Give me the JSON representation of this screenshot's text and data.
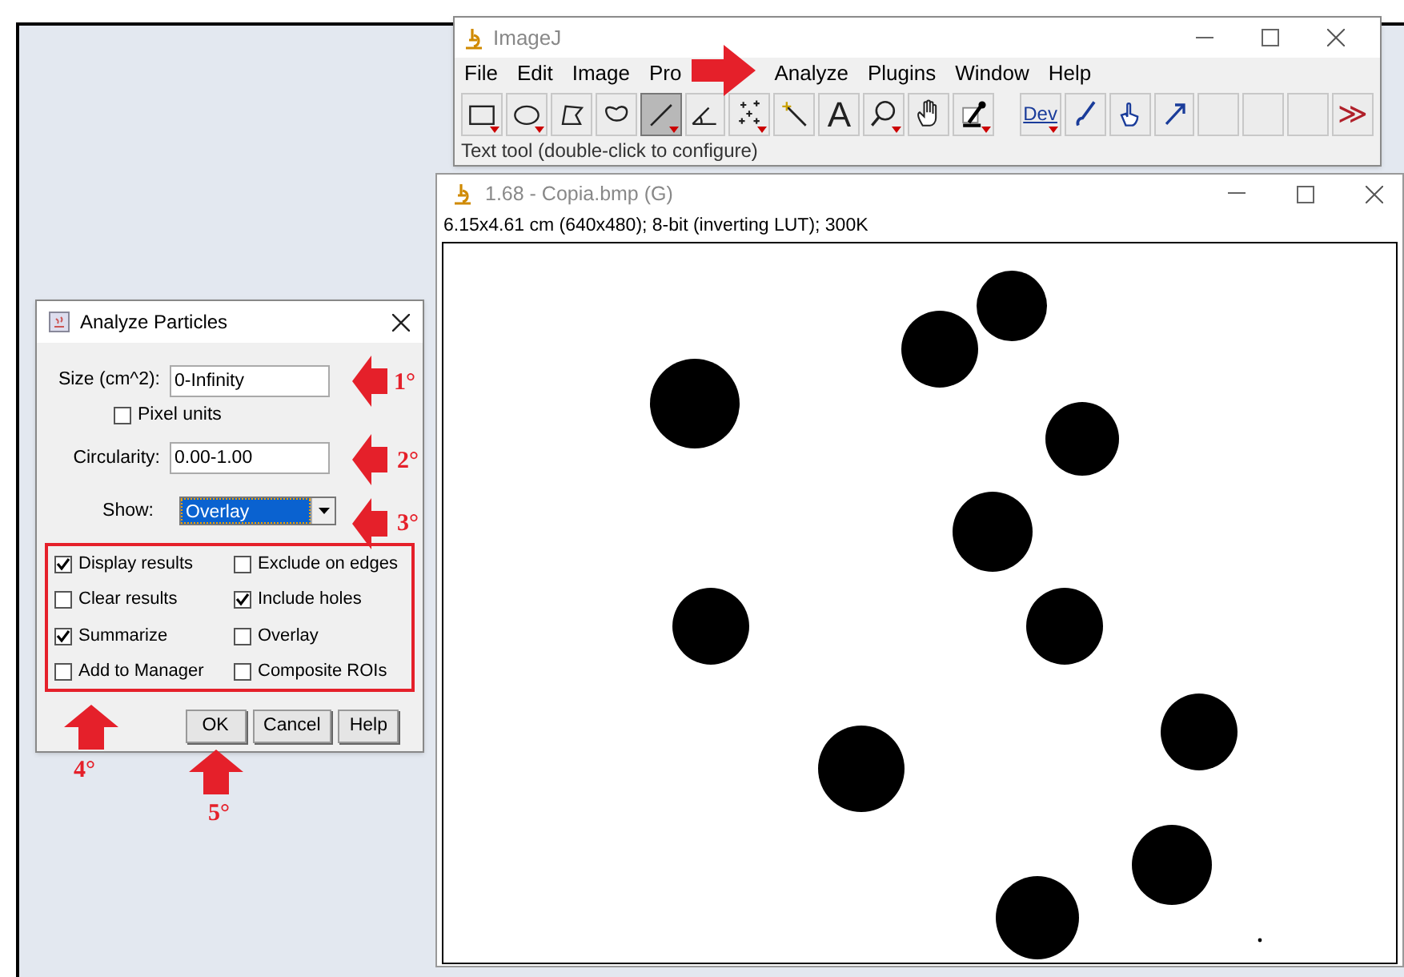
{
  "imagej_window": {
    "title": "ImageJ",
    "menu": [
      "File",
      "Edit",
      "Image",
      "Pro",
      "Analyze",
      "Plugins",
      "Window",
      "Help"
    ],
    "tools": [
      {
        "selected": false
      },
      {
        "selected": false
      },
      {
        "selected": false
      },
      {
        "selected": false
      },
      {
        "selected": true
      },
      {
        "selected": false
      },
      {
        "selected": false
      },
      {
        "selected": false
      },
      {
        "selected": false,
        "label": "A"
      },
      {
        "selected": false
      },
      {
        "selected": false
      },
      {
        "selected": false
      },
      {
        "selected": false,
        "label": "Dev"
      },
      {
        "selected": false
      },
      {
        "selected": false
      },
      {
        "selected": false
      },
      {
        "selected": false
      },
      {
        "selected": false
      },
      {
        "selected": false
      },
      {
        "selected": false,
        "label": "≫"
      }
    ],
    "status": "Text tool (double-click to configure)"
  },
  "image_window": {
    "title": "1.68 - Copia.bmp (G)",
    "info": "6.15x4.61 cm (640x480); 8-bit (inverting LUT); 300K"
  },
  "dialog": {
    "title": "Analyze Particles",
    "fields": [
      {
        "label": "Size (cm^2):",
        "value": "0-Infinity"
      },
      {
        "label": "Circularity:",
        "value": "0.00-1.00"
      }
    ],
    "pixel_units": {
      "label": "Pixel units",
      "checked": false
    },
    "show": {
      "label": "Show:",
      "value": "Overlay"
    },
    "options": [
      {
        "label": "Display results",
        "checked": true
      },
      {
        "label": "Exclude on edges",
        "checked": false
      },
      {
        "label": "Clear results",
        "checked": false
      },
      {
        "label": "Include holes",
        "checked": true
      },
      {
        "label": "Summarize",
        "checked": true
      },
      {
        "label": "Overlay",
        "checked": false
      },
      {
        "label": "Add to Manager",
        "checked": false
      },
      {
        "label": "Composite ROIs",
        "checked": false
      }
    ],
    "buttons": [
      "OK",
      "Cancel",
      "Help"
    ]
  },
  "annotations": [
    {
      "kind": "right"
    },
    {
      "kind": "left",
      "label": "1°"
    },
    {
      "kind": "left",
      "label": "2°"
    },
    {
      "kind": "left",
      "label": "3°"
    },
    {
      "kind": "up",
      "label": "4°"
    },
    {
      "kind": "up",
      "label": "5°"
    }
  ]
}
